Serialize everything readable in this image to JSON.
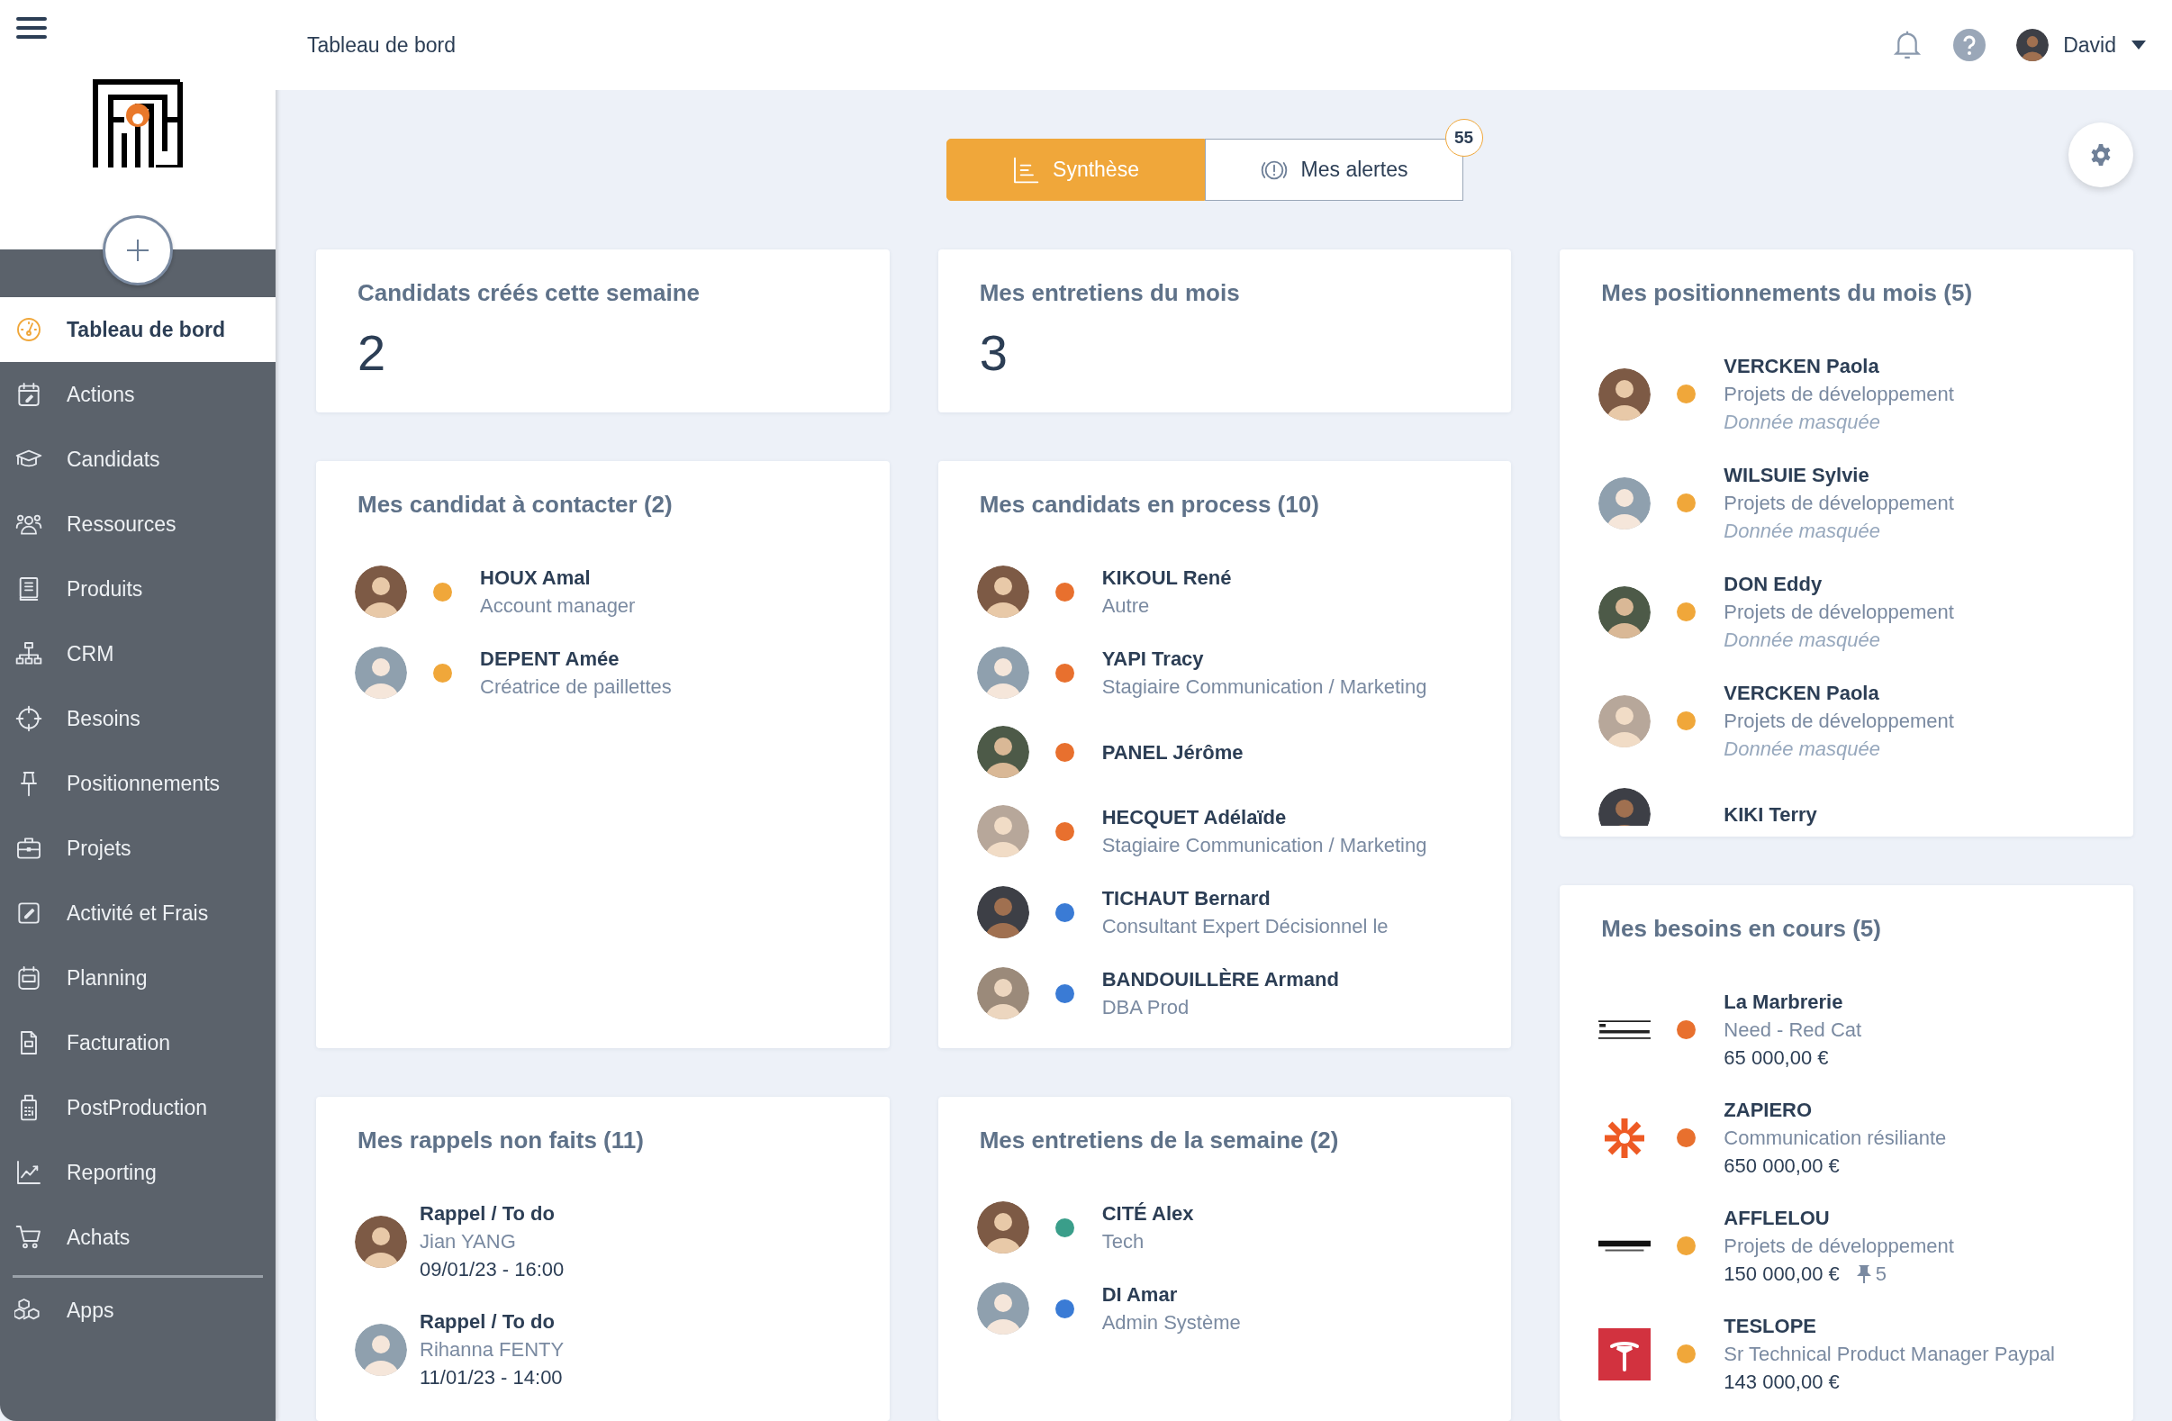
{
  "header": {
    "title": "Tableau de bord",
    "user": "David"
  },
  "sidebar": {
    "items": [
      {
        "label": "Tableau de bord",
        "selected": true
      },
      {
        "label": "Actions",
        "selected": false
      },
      {
        "label": "Candidats",
        "selected": false
      },
      {
        "label": "Ressources",
        "selected": false
      },
      {
        "label": "Produits",
        "selected": false
      },
      {
        "label": "CRM",
        "selected": false
      },
      {
        "label": "Besoins",
        "selected": false
      },
      {
        "label": "Positionnements",
        "selected": false
      },
      {
        "label": "Projets",
        "selected": false
      },
      {
        "label": "Activité et Frais",
        "selected": false
      },
      {
        "label": "Planning",
        "selected": false
      },
      {
        "label": "Facturation",
        "selected": false
      },
      {
        "label": "PostProduction",
        "selected": false
      },
      {
        "label": "Reporting",
        "selected": false
      },
      {
        "label": "Achats",
        "selected": false
      }
    ],
    "footer_items": [
      {
        "label": "Apps",
        "selected": false
      }
    ]
  },
  "tabs": [
    {
      "label": "Synthèse",
      "selected": true
    },
    {
      "label": "Mes alertes",
      "selected": false,
      "badge": "55"
    }
  ],
  "columns": [
    {
      "cards": [
        {
          "kind": "stat",
          "title": "Candidats créés cette semaine",
          "value": "2"
        },
        {
          "kind": "people",
          "title": "Mes candidat à contacter (2)",
          "items": [
            {
              "name": "HOUX Amal",
              "detail": "Account manager",
              "color": "#f0a73a"
            },
            {
              "name": "DEPENT Amée",
              "detail": "Créatrice de paillettes",
              "color": "#f0a73a"
            }
          ]
        },
        {
          "kind": "reminders",
          "title": "Mes rappels non faits (11)",
          "items": [
            {
              "type": "Rappel / To do",
              "contact": "Jian YANG",
              "when": "09/01/23 - 16:00"
            },
            {
              "type": "Rappel / To do",
              "contact": "Rihanna FENTY",
              "when": "11/01/23 - 14:00"
            }
          ]
        }
      ]
    },
    {
      "cards": [
        {
          "kind": "stat",
          "title": "Mes entretiens du mois",
          "value": "3"
        },
        {
          "kind": "people",
          "title": "Mes candidats en process (10)",
          "items": [
            {
              "name": "KIKOUL René",
              "detail": "Autre",
              "color": "#e8702e"
            },
            {
              "name": "YAPI Tracy",
              "detail": "Stagiaire Communication / Marketing",
              "color": "#e8702e"
            },
            {
              "name": "PANEL Jérôme",
              "color": "#e8702e"
            },
            {
              "name": "HECQUET Adélaïde",
              "detail": "Stagiaire Communication / Marketing",
              "color": "#e8702e"
            },
            {
              "name": "TICHAUT Bernard",
              "detail": "Consultant Expert Décisionnel le",
              "color": "#3a7bd5"
            },
            {
              "name": "BANDOUILLÈRE Armand",
              "detail": "DBA Prod",
              "color": "#3a7bd5"
            }
          ]
        },
        {
          "kind": "people",
          "title": "Mes entretiens de la semaine (2)",
          "items": [
            {
              "name": "CITÉ Alex",
              "detail": "Tech",
              "color": "#3a9e8a"
            },
            {
              "name": "DI Amar",
              "detail": "Admin Système",
              "color": "#3a7bd5"
            }
          ]
        }
      ]
    },
    {
      "cards": [
        {
          "kind": "people",
          "title": "Mes positionnements du mois (5)",
          "items": [
            {
              "name": "VERCKEN Paola",
              "detail": "Projets de développement",
              "note": "Donnée masquée",
              "color": "#f0a73a"
            },
            {
              "name": "WILSUIE Sylvie",
              "detail": "Projets de développement",
              "note": "Donnée masquée",
              "color": "#f0a73a"
            },
            {
              "name": "DON Eddy",
              "detail": "Projets de développement",
              "note": "Donnée masquée",
              "color": "#f0a73a"
            },
            {
              "name": "VERCKEN Paola",
              "detail": "Projets de développement",
              "note": "Donnée masquée",
              "color": "#f0a73a"
            },
            {
              "name": "KIKI Terry"
            }
          ]
        },
        {
          "kind": "needs",
          "title": "Mes besoins en cours (5)",
          "items": [
            {
              "company": "La Marbrerie",
              "detail": "Need - Red Cat",
              "amount": "65 000,00 €",
              "color": "#e8702e"
            },
            {
              "company": "ZAPIERO",
              "detail": "Communication résiliante",
              "amount": "650 000,00 €",
              "color": "#e8702e"
            },
            {
              "company": "AFFLELOU",
              "detail": "Projets de développement",
              "amount": "150 000,00 €",
              "pins": "5",
              "color": "#f0a73a"
            },
            {
              "company": "TESLOPE",
              "detail": "Sr Technical Product Manager Paypal",
              "amount": "143 000,00 €",
              "color": "#f0a73a"
            }
          ]
        }
      ]
    }
  ]
}
